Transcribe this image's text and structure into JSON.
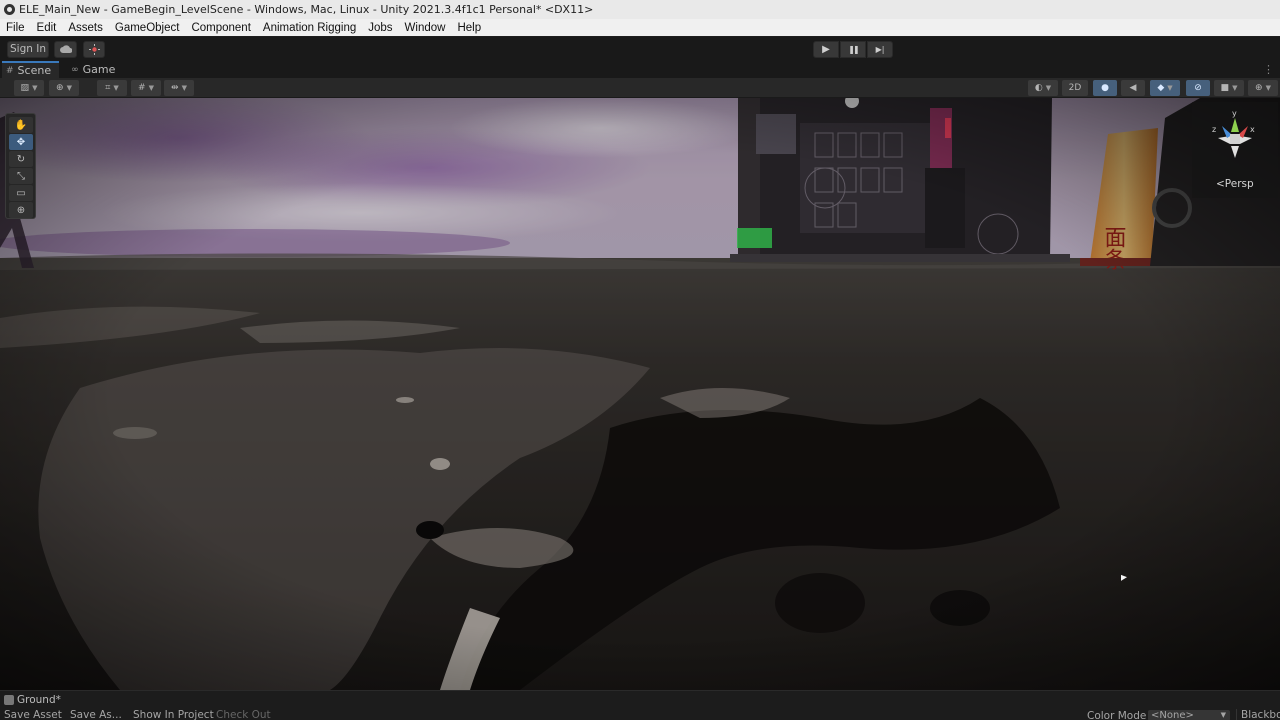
{
  "window": {
    "title": "ELE_Main_New - GameBegin_LevelScene - Windows, Mac, Linux - Unity 2021.3.4f1c1 Personal* <DX11>"
  },
  "menu": [
    "File",
    "Edit",
    "Assets",
    "GameObject",
    "Component",
    "Animation Rigging",
    "Jobs",
    "Window",
    "Help"
  ],
  "toolbar": {
    "sign_in_label": "Sign In",
    "cloud_icon": "cloud-icon",
    "collab_icon": "collab-icon",
    "play_icon": "▶",
    "pause_icon": "❚❚",
    "step_icon": "▶|"
  },
  "tabs": [
    {
      "label": "Scene",
      "icon": "#"
    },
    {
      "label": "Game",
      "icon": "∞"
    }
  ],
  "scene_toolbar": {
    "mode_2d_label": "2D"
  },
  "tools": [
    {
      "name": "hand-tool",
      "glyph": "✋"
    },
    {
      "name": "move-tool",
      "glyph": "✥"
    },
    {
      "name": "rotate-tool",
      "glyph": "↻"
    },
    {
      "name": "scale-tool",
      "glyph": "⤡"
    },
    {
      "name": "rect-tool",
      "glyph": "▭"
    },
    {
      "name": "transform-tool",
      "glyph": "⊕"
    }
  ],
  "gizmo": {
    "persp_label": "<Persp",
    "y_label": "y",
    "x_label": "x",
    "z_label": "z"
  },
  "scene": {
    "sign_text": "面条"
  },
  "status_bar": {
    "inspector_title": "Ground*",
    "save_asset": "Save Asset",
    "save_as": "Save As...",
    "show_in_project": "Show In Project",
    "check_out": "Check Out",
    "color_mode_label": "Color Mode",
    "color_mode_value": "<None>",
    "blackbody_label": "Blackbody"
  }
}
